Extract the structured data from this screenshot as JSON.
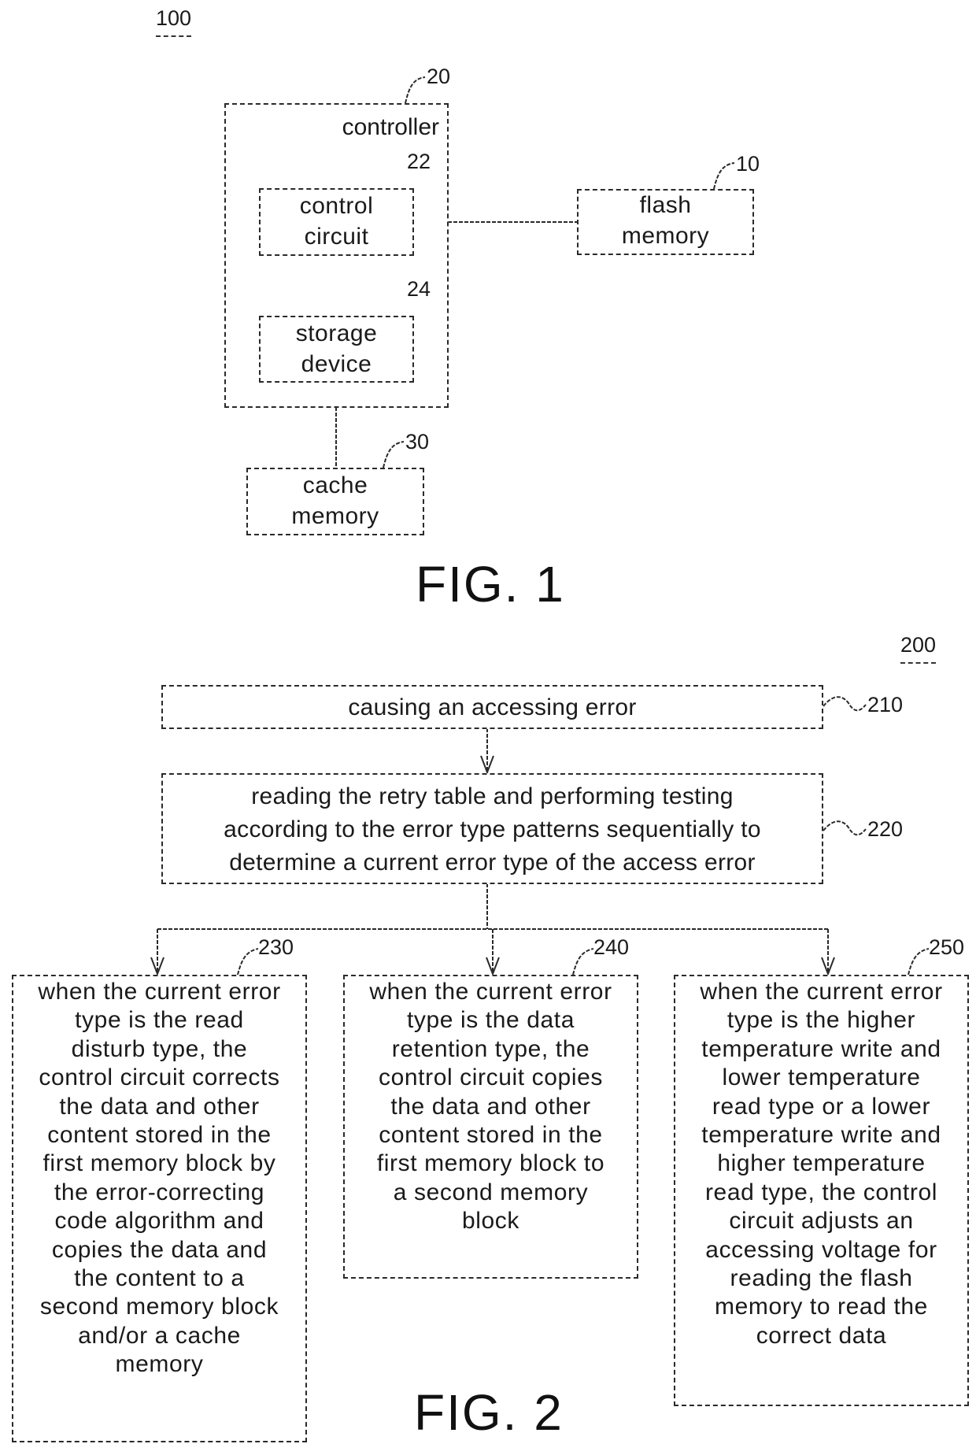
{
  "fig1": {
    "ref_label": "100",
    "caption": "FIG. 1",
    "controller": {
      "label": "controller",
      "ref": "20"
    },
    "control_circuit": {
      "lines": [
        "control",
        "circuit"
      ],
      "ref": "22"
    },
    "storage_device": {
      "lines": [
        "storage",
        "device"
      ],
      "ref": "24"
    },
    "flash_memory": {
      "lines": [
        "flash",
        "memory"
      ],
      "ref": "10"
    },
    "cache_memory": {
      "lines": [
        "cache",
        "memory"
      ],
      "ref": "30"
    }
  },
  "fig2": {
    "ref_label": "200",
    "caption": "FIG. 2",
    "step_210": {
      "ref": "210",
      "text": "causing an accessing error"
    },
    "step_220": {
      "ref": "220",
      "lines": [
        "reading the retry table and performing testing",
        "according to the error type patterns sequentially to",
        "determine a current error type of the access error"
      ]
    },
    "step_230": {
      "ref": "230",
      "lines": [
        "when the current error",
        "type is the read",
        "disturb type, the",
        "control circuit corrects",
        "the data and other",
        "content stored in the",
        "first memory block by",
        "the error-correcting",
        "code algorithm and",
        "copies the data and",
        "the content to a",
        "second memory block",
        "and/or a cache",
        "memory"
      ]
    },
    "step_240": {
      "ref": "240",
      "lines": [
        "when the current error",
        "type is the data",
        "retention type, the",
        "control circuit copies",
        "the data and other",
        "content stored in the",
        "first memory block to",
        "a second memory",
        "block"
      ]
    },
    "step_250": {
      "ref": "250",
      "lines": [
        "when the current error",
        "type is the higher",
        "temperature write and",
        "lower temperature",
        "read type or a lower",
        "temperature write and",
        "higher temperature",
        "read type, the control",
        "circuit adjusts an",
        "accessing voltage for",
        "reading the flash",
        "memory to read the",
        "correct data"
      ]
    }
  }
}
